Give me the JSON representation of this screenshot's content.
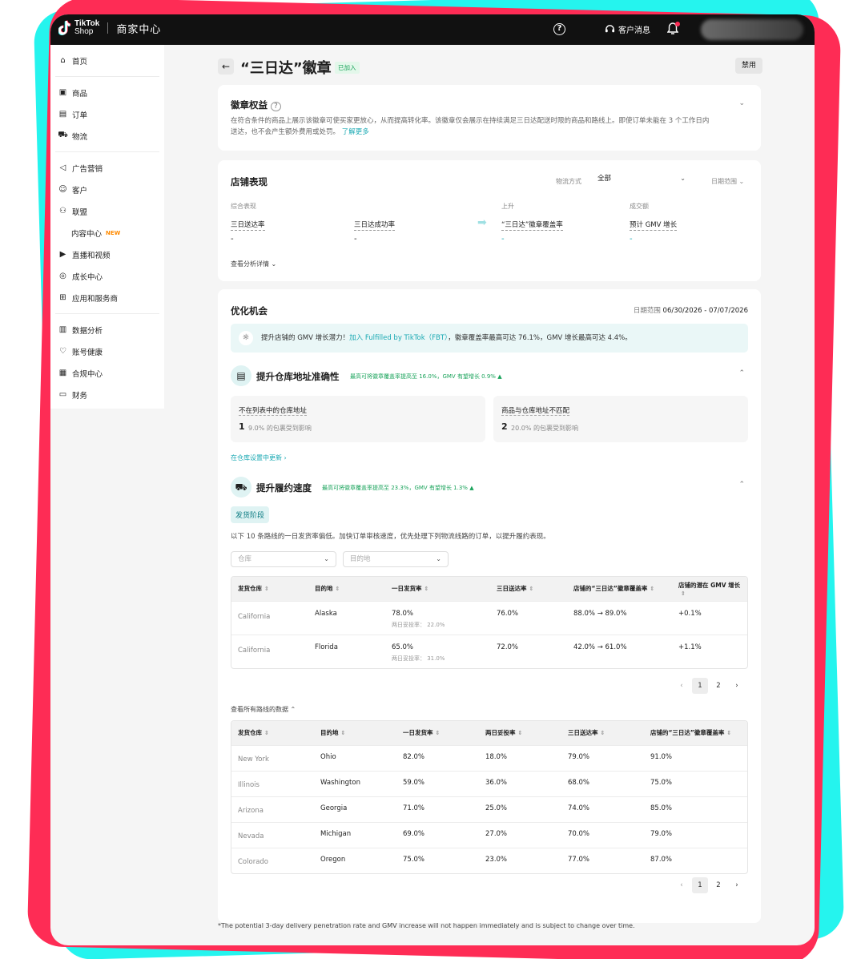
{
  "topbar": {
    "logo_line1": "TikTok",
    "logo_line2": "Shop",
    "portal_title": "商家中心",
    "help_icon": "?",
    "messages_label": "客户消息"
  },
  "sidebar": {
    "groups": [
      [
        {
          "label": "首页",
          "icon": "home-icon"
        }
      ],
      [
        {
          "label": "商品",
          "icon": "product-icon"
        },
        {
          "label": "订单",
          "icon": "order-icon"
        },
        {
          "label": "物流",
          "icon": "truck-icon"
        }
      ],
      [
        {
          "label": "广告营销",
          "icon": "megaphone-icon"
        },
        {
          "label": "客户",
          "icon": "customer-icon"
        },
        {
          "label": "联盟",
          "icon": "affiliate-icon"
        },
        {
          "label": "内容中心",
          "tag": "NEW"
        },
        {
          "label": "直播和视频",
          "icon": "video-icon"
        },
        {
          "label": "成长中心",
          "icon": "growth-icon"
        },
        {
          "label": "应用和服务商",
          "icon": "apps-icon"
        }
      ],
      [
        {
          "label": "数据分析",
          "icon": "chart-icon"
        },
        {
          "label": "账号健康",
          "icon": "health-icon"
        },
        {
          "label": "合规中心",
          "icon": "compliance-icon"
        },
        {
          "label": "财务",
          "icon": "finance-icon"
        }
      ]
    ]
  },
  "header": {
    "title": "“三日达”徽章",
    "status_tag": "已加入",
    "disable_label": "禁用"
  },
  "rights": {
    "title": "徽章权益",
    "description": "在符合条件的商品上展示该徽章可使买家更放心，从而提高转化率。该徽章仅会展示在持续满足三日达配送时限的商品和路线上。即使订单未能在 3 个工作日内送达，也不会产生额外费用或处罚。",
    "learn_more": "了解更多"
  },
  "performance": {
    "title": "店铺表现",
    "shipping_method_label": "物流方式",
    "shipping_method_value": "全部",
    "date_range_label": "日期范围",
    "overall_label": "综合表现",
    "uplift_label": "上升",
    "gmv_label": "成交额",
    "metric1": "三日送达率",
    "metric1_value": "-",
    "metric2": "三日达成功率",
    "metric2_value": "-",
    "metric3": "“三日达”徽章覆盖率",
    "metric3_value": "-",
    "metric4": "预计 GMV 增长",
    "metric4_value": "-",
    "details_link": "查看分析详情"
  },
  "opportunity": {
    "title": "优化机会",
    "date_range_label": "日期范围",
    "date_range": "06/30/2026 - 07/07/2026",
    "banner_prefix": "提升店铺的 GMV 增长潜力！",
    "banner_link": "加入 Fulfilled by TikTok（FBT）",
    "banner_suffix": "，徽章覆盖率最高可达 76.1%，GMV 增长最高可达 4.4%。",
    "warehouse": {
      "title": "提升仓库地址准确性",
      "note": "最高可将徽章覆盖率提高至 16.0%，GMV 有望增长 0.9%",
      "card1_title": "不在列表中的仓库地址",
      "card1_count": "1",
      "card1_desc": "9.0% 的包裹受到影响",
      "card2_title": "商品与仓库地址不匹配",
      "card2_count": "2",
      "card2_desc": "20.0% 的包裹受到影响",
      "update_link": "在仓库设置中更新"
    },
    "fulfillment": {
      "title": "提升履约速度",
      "note": "最高可将徽章覆盖率提高至 23.3%，GMV 有望增长 1.3%",
      "stage_pill": "发货阶段",
      "desc": "以下 10 条路线的一日发货率偏低。加快订单审核速度，优先处理下列物流线路的订单，以提升履约表现。",
      "filter_warehouse": "仓库",
      "filter_destination": "目的地",
      "table1": {
        "headers": [
          "发货仓库",
          "目的地",
          "一日发货率",
          "三日送达率",
          "店铺的“三日达”徽章覆盖率",
          "店铺的潜在 GMV 增长"
        ],
        "rows": [
          {
            "wh": "California",
            "dest": "Alaska",
            "rate": "78.0%",
            "sub": "两日妥投率： 22.0%",
            "d3": "76.0%",
            "cov": "88.0% → 89.0%",
            "gmv": "+0.1%"
          },
          {
            "wh": "California",
            "dest": "Florida",
            "rate": "65.0%",
            "sub": "两日妥投率： 31.0%",
            "d3": "72.0%",
            "cov": "42.0% → 61.0%",
            "gmv": "+1.1%"
          }
        ]
      },
      "pager1": {
        "prev": "‹",
        "p1": "1",
        "p2": "2",
        "next": "›"
      },
      "all_routes_link": "查看所有路线的数据",
      "table2": {
        "headers": [
          "发货仓库",
          "目的地",
          "一日发货率",
          "两日妥投率",
          "三日送达率",
          "店铺的“三日达”徽章覆盖率"
        ],
        "rows": [
          [
            "New York",
            "Ohio",
            "82.0%",
            "18.0%",
            "79.0%",
            "91.0%"
          ],
          [
            "Illinois",
            "Washington",
            "59.0%",
            "36.0%",
            "68.0%",
            "75.0%"
          ],
          [
            "Arizona",
            "Georgia",
            "71.0%",
            "25.0%",
            "74.0%",
            "85.0%"
          ],
          [
            "Nevada",
            "Michigan",
            "69.0%",
            "27.0%",
            "70.0%",
            "79.0%"
          ],
          [
            "Colorado",
            "Oregon",
            "75.0%",
            "23.0%",
            "77.0%",
            "87.0%"
          ]
        ]
      },
      "pager2": {
        "prev": "‹",
        "p1": "1",
        "p2": "2",
        "next": "›"
      }
    }
  },
  "footnote": "*The potential 3-day delivery penetration rate and GMV increase will not happen immediately and is subject to change over time.",
  "colors": {
    "accent": "#1aa9b3",
    "brand_red": "#fe2c55",
    "brand_cyan": "#25f4ee",
    "success": "#1aa35b"
  }
}
